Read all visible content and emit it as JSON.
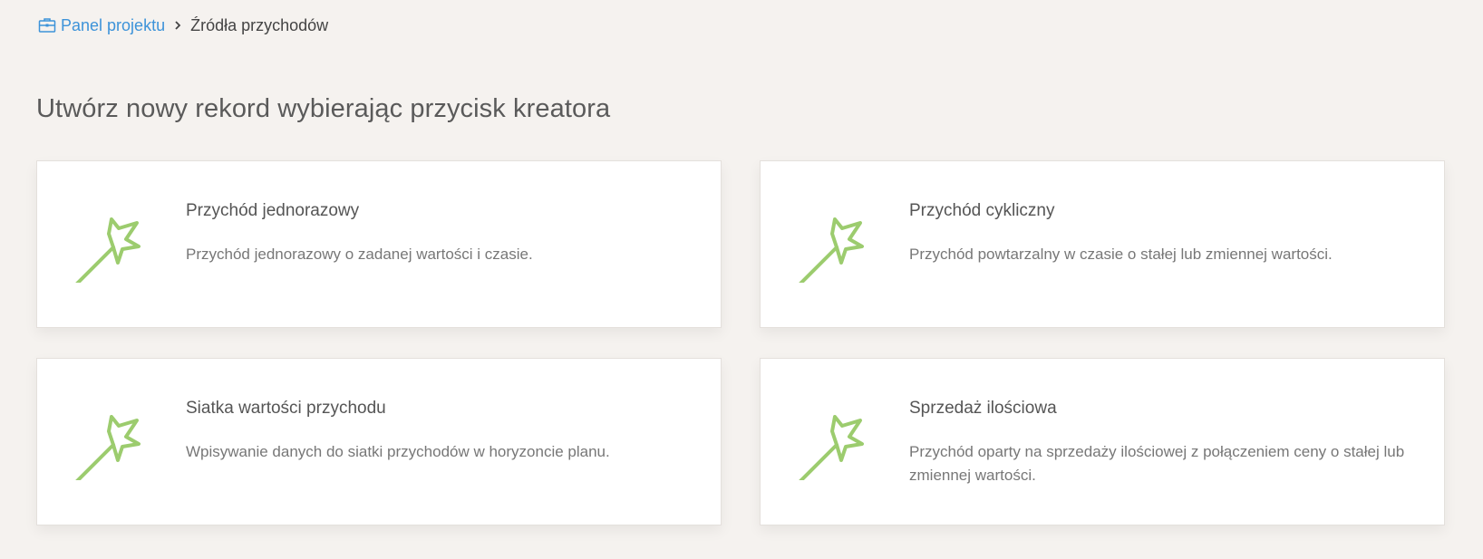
{
  "breadcrumb": {
    "icon": "briefcase-icon",
    "link_label": "Panel projektu",
    "current_label": "Źródła przychodów"
  },
  "page": {
    "title": "Utwórz nowy rekord wybierając przycisk kreatora"
  },
  "cards": [
    {
      "icon": "magic-wand-icon",
      "title": "Przychód jednorazowy",
      "description": "Przychód jednorazowy o zadanej wartości i czasie."
    },
    {
      "icon": "magic-wand-icon",
      "title": "Przychód cykliczny",
      "description": "Przychód powtarzalny w czasie o stałej lub zmiennej wartości."
    },
    {
      "icon": "magic-wand-icon",
      "title": "Siatka wartości przychodu",
      "description": "Wpisywanie danych do siatki przychodów w horyzoncie planu."
    },
    {
      "icon": "magic-wand-icon",
      "title": "Sprzedaż ilościowa",
      "description": "Przychód oparty na sprzedaży ilościowej z połączeniem ceny o stałej lub zmiennej wartości."
    }
  ],
  "colors": {
    "background": "#f5f2ef",
    "link": "#3d93d9",
    "wand": "#9ccc6e",
    "card": "#ffffff"
  }
}
